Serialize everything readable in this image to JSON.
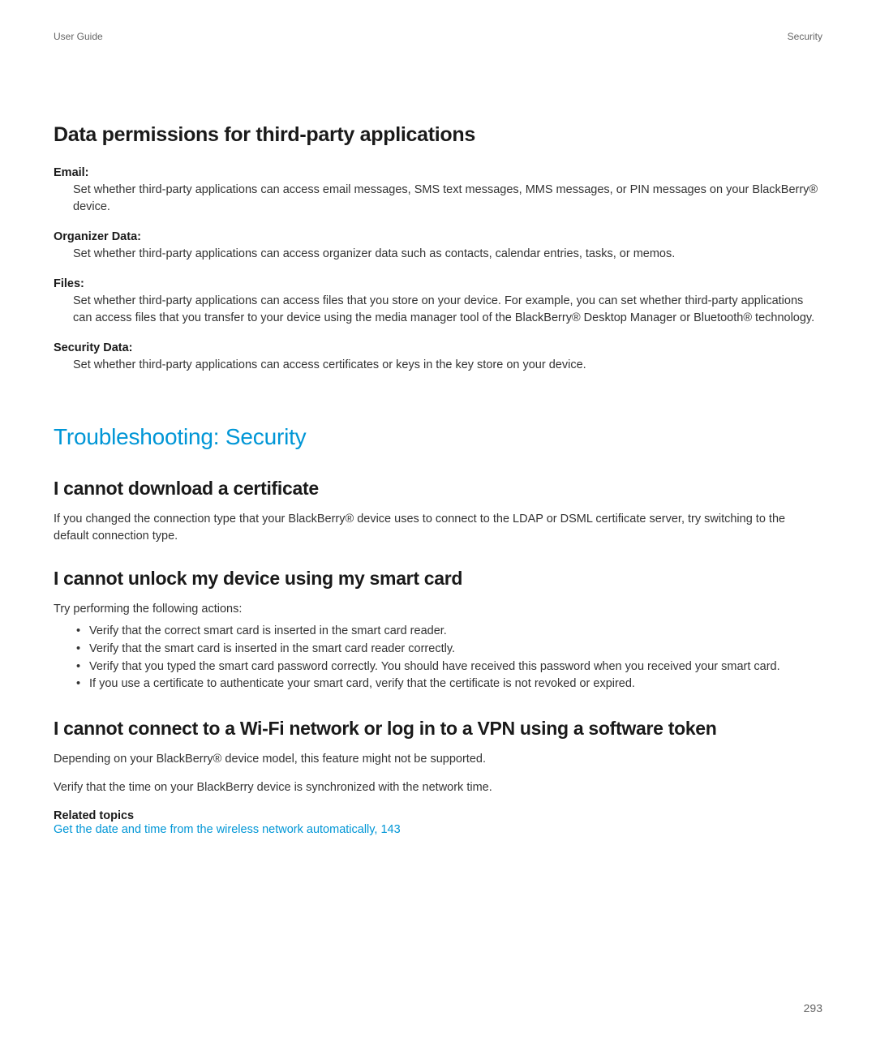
{
  "header": {
    "left": "User Guide",
    "right": "Security"
  },
  "section1": {
    "heading": "Data permissions for third-party applications",
    "terms": [
      {
        "label": "Email:",
        "desc": "Set whether third-party applications can access email messages, SMS text messages, MMS messages, or PIN messages on your BlackBerry® device."
      },
      {
        "label": "Organizer Data:",
        "desc": "Set whether third-party applications can access organizer data such as contacts, calendar entries, tasks, or memos."
      },
      {
        "label": "Files:",
        "desc": "Set whether third-party applications can access files that you store on your device. For example, you can set whether third-party applications can access files that you transfer to your device using the media manager tool of the BlackBerry® Desktop Manager or Bluetooth® technology."
      },
      {
        "label": "Security Data:",
        "desc": "Set whether third-party applications can access certificates or keys in the key store on your device."
      }
    ]
  },
  "section2": {
    "heading": "Troubleshooting: Security",
    "sub1": {
      "heading": "I cannot download a certificate",
      "text": "If you changed the connection type that your BlackBerry® device uses to connect to the LDAP or DSML certificate server, try switching to the default connection type."
    },
    "sub2": {
      "heading": "I cannot unlock my device using my smart card",
      "intro": "Try performing the following actions:",
      "bullets": [
        "Verify that the correct smart card is inserted in the smart card reader.",
        "Verify that the smart card is inserted in the smart card reader correctly.",
        "Verify that you typed the smart card password correctly. You should have received this password when you received your smart card.",
        "If you use a certificate to authenticate your smart card, verify that the certificate is not revoked or expired."
      ]
    },
    "sub3": {
      "heading": "I cannot connect to a Wi-Fi network or log in to a VPN using a software token",
      "text1": "Depending on your BlackBerry® device model, this feature might not be supported.",
      "text2": "Verify that the time on your BlackBerry device is synchronized with the network time.",
      "related_label": "Related topics",
      "related_link": "Get the date and time from the wireless network automatically, 143"
    }
  },
  "page_number": "293"
}
